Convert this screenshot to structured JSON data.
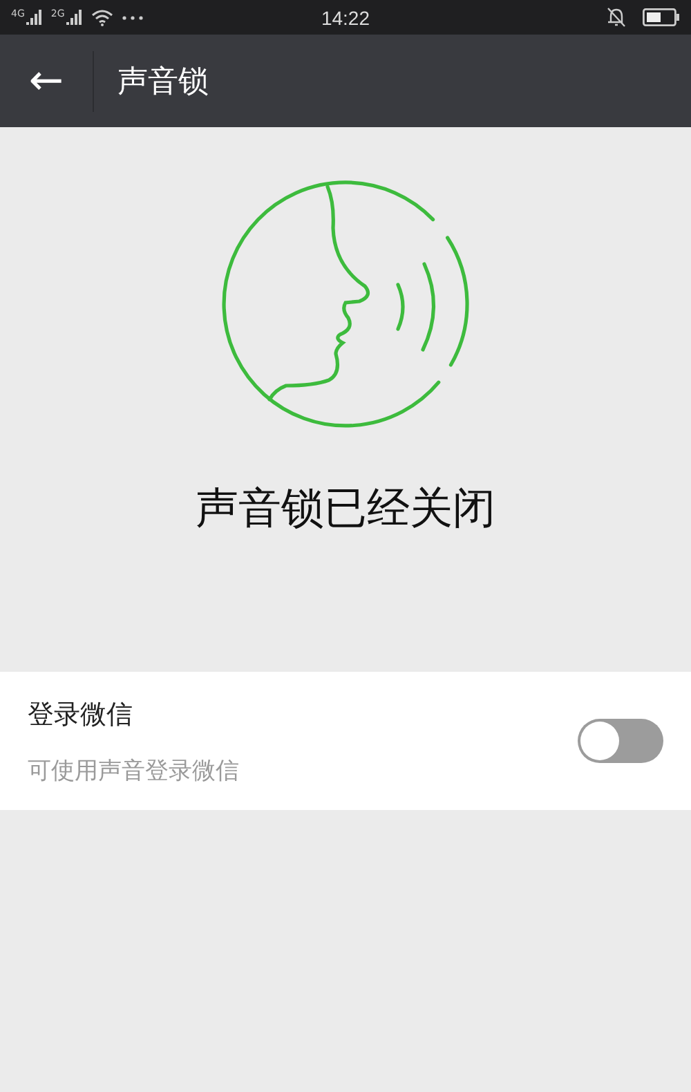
{
  "status_bar": {
    "signals": [
      "4G",
      "2G"
    ],
    "time": "14:22"
  },
  "header": {
    "back": "←",
    "title": "声音锁"
  },
  "status_text": "声音锁已经关闭",
  "settings": [
    {
      "label": "登录微信",
      "description": "可使用声音登录微信",
      "on": false
    }
  ]
}
